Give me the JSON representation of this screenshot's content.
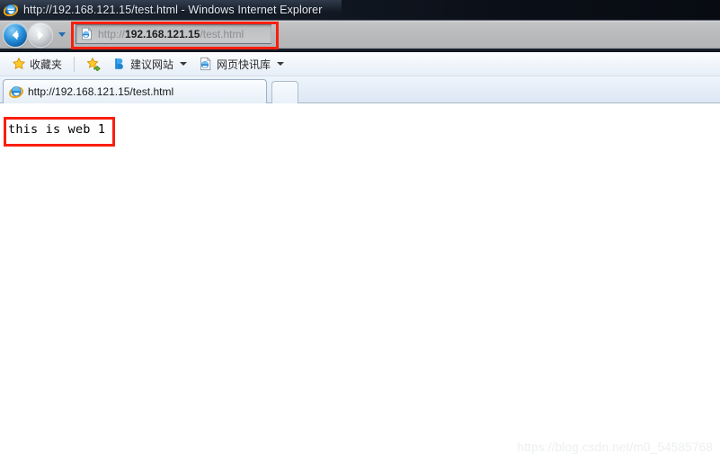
{
  "window": {
    "title": "http://192.168.121.15/test.html - Windows Internet Explorer",
    "app_icon": "internet-explorer-icon"
  },
  "navigation": {
    "back_label": "Back",
    "forward_label": "Forward",
    "recent_pages_label": "Recent Pages"
  },
  "address_bar": {
    "url_full": "http://192.168.121.15/test.html",
    "url_prefix": "http://",
    "url_host": "192.168.121.15",
    "url_path": "/test.html",
    "favicon": "page-icon"
  },
  "favorites_bar": {
    "favorites_label": "收藏夹",
    "favorites_icon": "star-icon",
    "add_to_favorites_icon": "add-favorite-icon",
    "items": [
      {
        "label": "建议网站",
        "icon": "suggested-sites-icon",
        "has_dropdown": true
      },
      {
        "label": "网页快讯库",
        "icon": "web-slice-icon",
        "has_dropdown": true
      }
    ]
  },
  "tabs": {
    "items": [
      {
        "label": "http://192.168.121.15/test.html",
        "icon": "internet-explorer-icon",
        "active": true
      }
    ],
    "new_tab_label": ""
  },
  "page": {
    "body_text": "this is web 1",
    "watermark": "https://blog.csdn.net/m0_54585768"
  },
  "colors": {
    "annotation_red": "#fa1e0e",
    "titlebar_dark": "#0b0f17",
    "toolbar_grey": "#b9babc",
    "favbar_blue": "#e7eef7"
  }
}
